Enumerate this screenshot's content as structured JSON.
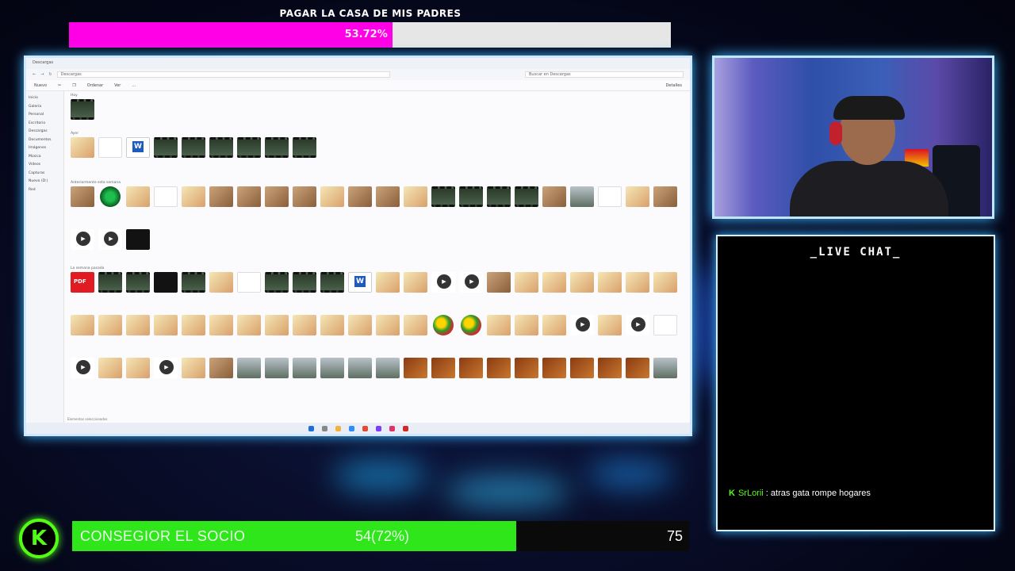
{
  "top_goal": {
    "title": "PAGAR LA CASA DE MIS PADRES",
    "percent_label": "53.72%",
    "fraction": 0.5372,
    "fill_color": "#ff00e6"
  },
  "explorer": {
    "window_title": "Descargas",
    "address": "Descargas",
    "search_placeholder": "Buscar en Descargas",
    "commands": [
      "Nuevo",
      "Ordenar",
      "Ver",
      "..."
    ],
    "details_label": "Detalles",
    "nav_items": [
      "Inicio",
      "Galería",
      "Personal",
      "Escritorio",
      "Descargas",
      "Documentos",
      "Imágenes",
      "Música",
      "Vídeos",
      "Capturas",
      "Nuevo (D:)",
      "Red"
    ],
    "sections": [
      "Hoy",
      "Ayer",
      "Anteriormente esta semana",
      "La semana pasada"
    ],
    "status": "Elementos seleccionados"
  },
  "chat": {
    "title": "_LIVE CHAT_",
    "messages": [
      {
        "badge": "K",
        "user": "SrLorii",
        "separator": " : ",
        "text": "atras gata rompe hogares"
      }
    ]
  },
  "bottom_goal": {
    "label": "CONSEGIOR EL SOCIO",
    "progress_label": "54(72%)",
    "target": "75",
    "fraction": 0.72,
    "fill_color": "#2ee61a"
  },
  "logo": {
    "icon": "kick-logo-icon",
    "letter": "K"
  }
}
